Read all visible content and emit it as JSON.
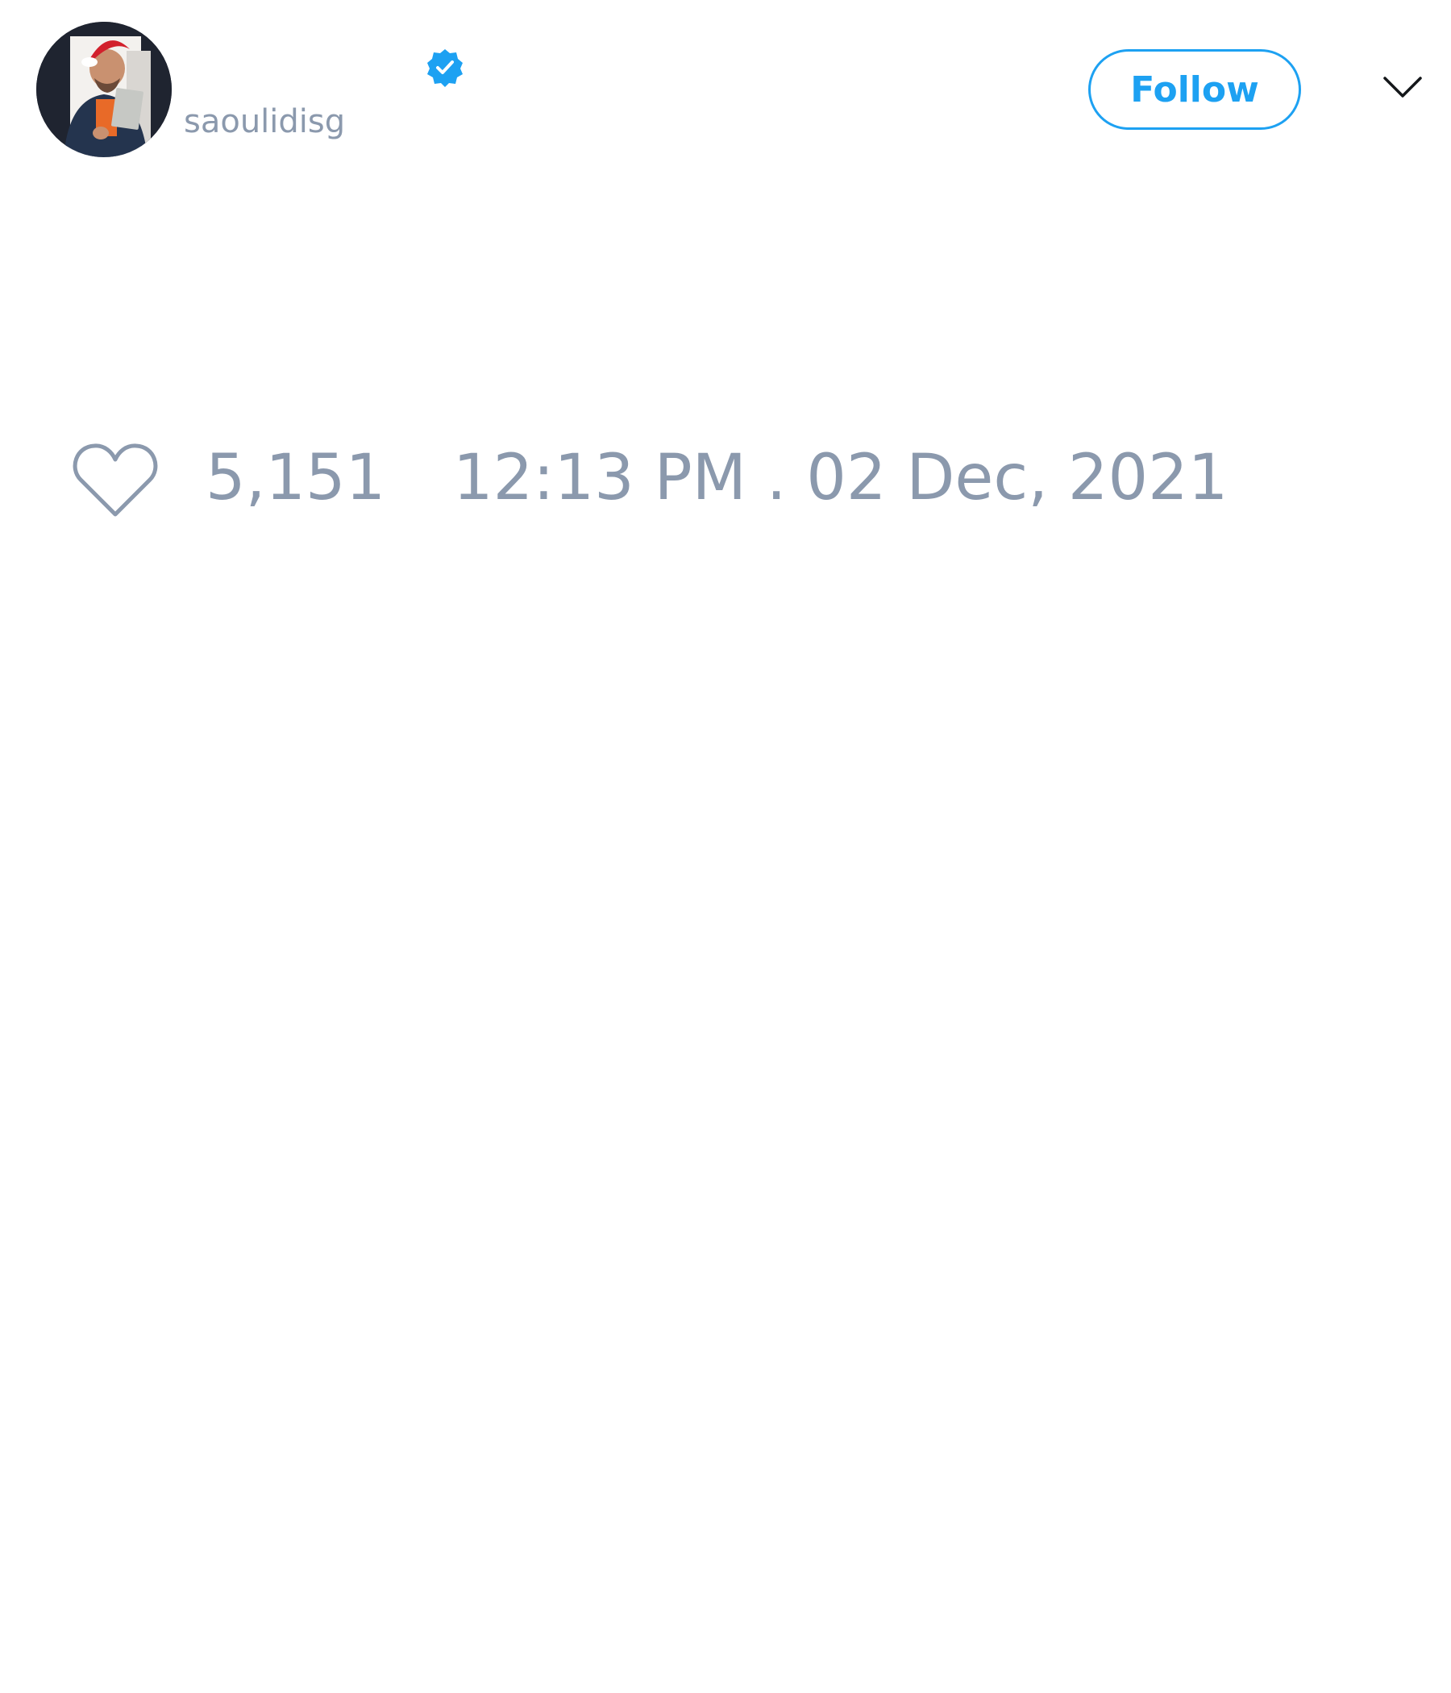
{
  "tweet": {
    "author": {
      "display_name": "",
      "username": "saoulidisg",
      "verified": true,
      "avatar": "profile-photo-icon"
    },
    "follow_label": "Follow",
    "menu_icon": "chevron-down-icon",
    "text": "",
    "likes": {
      "icon": "heart-icon",
      "count": "5,151"
    },
    "timestamp": "12:13 PM . 02 Dec, 2021"
  },
  "colors": {
    "accent": "#1da1f2",
    "muted_text": "#8b99ad",
    "background": "#ffffff"
  }
}
